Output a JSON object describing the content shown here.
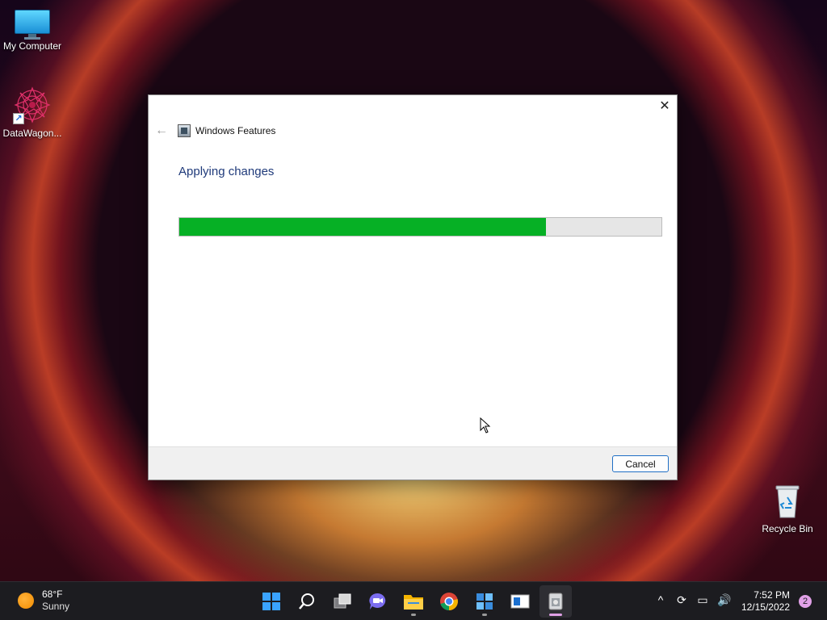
{
  "desktop": {
    "icons": [
      {
        "label": "My Computer",
        "icon": "monitor-icon"
      },
      {
        "label": "DataWagon...",
        "icon": "mandala-icon"
      },
      {
        "label": "Recycle Bin",
        "icon": "recycle-bin-icon"
      }
    ]
  },
  "dialog": {
    "title": "Windows Features",
    "heading": "Applying changes",
    "progress": 0.76,
    "cancel_label": "Cancel",
    "close_glyph": "✕",
    "back_glyph": "←"
  },
  "colors": {
    "progress_fill": "#06b025",
    "heading_text": "#1f3a7a",
    "taskbar_bg": "#1c1c20"
  },
  "taskbar": {
    "weather": {
      "temp": "68°F",
      "condition": "Sunny"
    },
    "apps": [
      "windows-start-icon",
      "search-icon",
      "task-view-icon",
      "chat-icon",
      "file-explorer-icon",
      "chrome-icon",
      "windows-features-icon",
      "media-app-icon",
      "installer-icon"
    ],
    "tray": {
      "chevron": "^",
      "sync": "⟳",
      "network": "▭",
      "volume": "🔊"
    },
    "clock": {
      "time": "7:52 PM",
      "date": "12/15/2022"
    },
    "notification_count": "2"
  }
}
